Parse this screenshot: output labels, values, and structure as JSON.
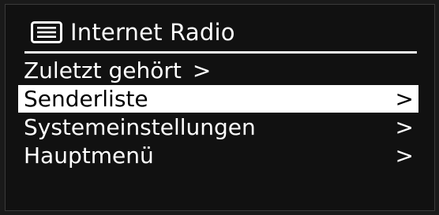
{
  "header": {
    "icon": "list-menu-icon",
    "title": "Internet Radio"
  },
  "menu": {
    "items": [
      {
        "label": "Zuletzt gehört",
        "arrow": ">",
        "selected": false,
        "arrow_inline": true
      },
      {
        "label": "Senderliste",
        "arrow": ">",
        "selected": true,
        "arrow_inline": false
      },
      {
        "label": "Systemeinstellungen",
        "arrow": ">",
        "selected": false,
        "arrow_inline": false
      },
      {
        "label": "Hauptmenü",
        "arrow": ">",
        "selected": false,
        "arrow_inline": false
      }
    ]
  },
  "colors": {
    "background": "#111111",
    "text": "#ffffff",
    "highlight": "#ffffff",
    "highlight_text": "#000000"
  }
}
